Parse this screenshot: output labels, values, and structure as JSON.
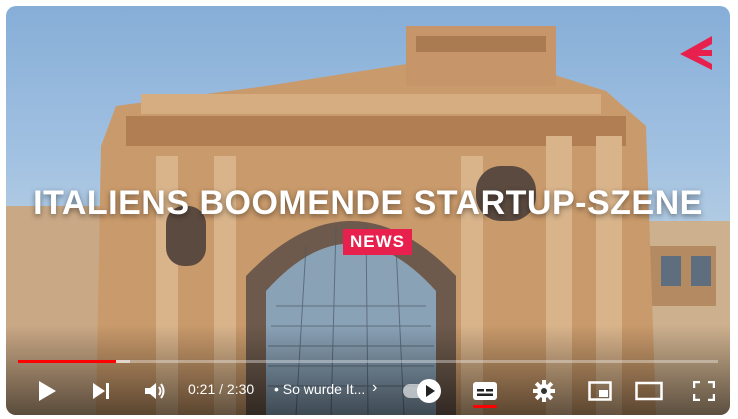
{
  "video": {
    "headline": "ITALIENS BOOMENDE STARTUP-SZENE",
    "badge": "NEWS",
    "logo_icon": "brand-logo-icon",
    "accent_color": "#e8204d"
  },
  "player": {
    "current_time": "0:21",
    "separator": "/",
    "duration": "2:30",
    "chapter_prefix": "•",
    "chapter_title": "So wurde It...",
    "chapter_chevron": "›",
    "progress_played_fraction": 0.14,
    "progress_loaded_fraction": 0.16,
    "progress_color": "#ff0000",
    "autoplay_on": true,
    "subtitles_on": true
  },
  "icons": {
    "play": "play-icon",
    "next": "next-icon",
    "volume": "volume-icon",
    "autoplay": "autoplay-toggle",
    "subtitles": "subtitles-icon",
    "settings": "settings-gear-icon",
    "miniplayer": "miniplayer-icon",
    "theater": "theater-mode-icon",
    "fullscreen": "fullscreen-icon"
  }
}
